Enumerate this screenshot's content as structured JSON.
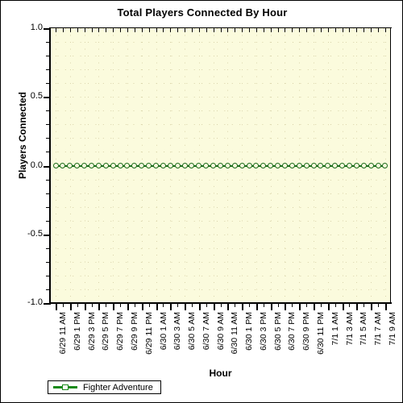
{
  "chart_data": {
    "type": "line",
    "title": "Total Players Connected By Hour",
    "xlabel": "Hour",
    "ylabel": "Players Connected",
    "ylim": [
      -1.0,
      1.0
    ],
    "ytick_labels": [
      "1.0",
      "0.5",
      "0.0",
      "-0.5",
      "-1.0"
    ],
    "ytick_values": [
      1.0,
      0.5,
      0.0,
      -0.5,
      -1.0
    ],
    "y_minor_step": 0.1,
    "grid": true,
    "legend_position": "bottom-left",
    "series": [
      {
        "name": "Fighter Adventure",
        "color": "#1a6b1a",
        "marker": "circle",
        "values": [
          0,
          0,
          0,
          0,
          0,
          0,
          0,
          0,
          0,
          0,
          0,
          0,
          0,
          0,
          0,
          0,
          0,
          0,
          0,
          0,
          0,
          0,
          0,
          0,
          0,
          0,
          0,
          0,
          0,
          0,
          0,
          0,
          0,
          0,
          0,
          0,
          0,
          0,
          0,
          0,
          0,
          0,
          0,
          0,
          0,
          0,
          0
        ]
      }
    ],
    "categories": [
      "6/29 11 AM",
      "6/29 12 PM",
      "6/29 1 PM",
      "6/29 2 PM",
      "6/29 3 PM",
      "6/29 4 PM",
      "6/29 5 PM",
      "6/29 6 PM",
      "6/29 7 PM",
      "6/29 8 PM",
      "6/29 9 PM",
      "6/29 10 PM",
      "6/29 11 PM",
      "6/30 12 AM",
      "6/30 1 AM",
      "6/30 2 AM",
      "6/30 3 AM",
      "6/30 4 AM",
      "6/30 5 AM",
      "6/30 6 AM",
      "6/30 7 AM",
      "6/30 8 AM",
      "6/30 9 AM",
      "6/30 10 AM",
      "6/30 11 AM",
      "6/30 12 PM",
      "6/30 1 PM",
      "6/30 2 PM",
      "6/30 3 PM",
      "6/30 4 PM",
      "6/30 5 PM",
      "6/30 6 PM",
      "6/30 7 PM",
      "6/30 8 PM",
      "6/30 9 PM",
      "6/30 10 PM",
      "6/30 11 PM",
      "7/1 12 AM",
      "7/1 1 AM",
      "7/1 2 AM",
      "7/1 3 AM",
      "7/1 4 AM",
      "7/1 5 AM",
      "7/1 6 AM",
      "7/1 7 AM",
      "7/1 8 AM",
      "7/1 9 AM"
    ],
    "xtick_labels": [
      "6/29 11 AM",
      "6/29 1 PM",
      "6/29 3 PM",
      "6/29 5 PM",
      "6/29 7 PM",
      "6/29 9 PM",
      "6/29 11 PM",
      "6/30 1 AM",
      "6/30 3 AM",
      "6/30 5 AM",
      "6/30 7 AM",
      "6/30 9 AM",
      "6/30 11 AM",
      "6/30 1 PM",
      "6/30 3 PM",
      "6/30 5 PM",
      "6/30 7 PM",
      "6/30 9 PM",
      "6/30 11 PM",
      "7/1 1 AM",
      "7/1 3 AM",
      "7/1 5 AM",
      "7/1 7 AM",
      "7/1 9 AM"
    ],
    "colors": {
      "plot_background": "#fbfbdd",
      "grid": "#d8d2a8",
      "axis": "#000000",
      "series": "#1a6b1a",
      "legend_swatch": "#1a8a1a",
      "page_background": "#ffffff"
    }
  },
  "legend": {
    "items": [
      {
        "label": "Fighter Adventure"
      }
    ]
  }
}
